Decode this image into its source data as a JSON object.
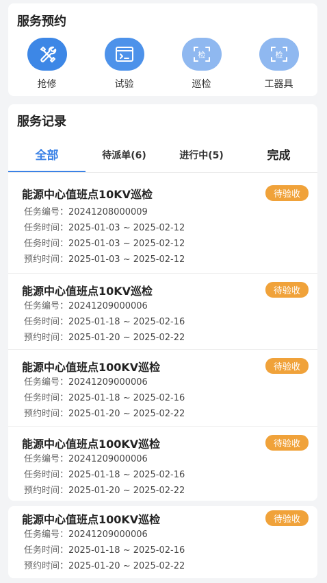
{
  "booking": {
    "title": "服务预约",
    "items": [
      {
        "label": "抢修",
        "icon": "wrench-screwdriver-icon",
        "color": "#3d87e6"
      },
      {
        "label": "试验",
        "icon": "terminal-window-icon",
        "color": "#4d92ea"
      },
      {
        "label": "巡检",
        "icon": "scan-inspect-icon",
        "color": "#8fb8f0"
      },
      {
        "label": "工器具",
        "icon": "scan-inspect-icon",
        "color": "#8fb8f0"
      }
    ]
  },
  "records": {
    "title": "服务记录",
    "tabs": [
      "全部",
      "待派单(6)",
      "进行中(5)",
      "完成"
    ],
    "items": [
      {
        "title": "能源中心值班点10KV巡检",
        "status": "待验收",
        "lines": [
          {
            "label": "任务编号：",
            "value": "20241208000009"
          },
          {
            "label": "任务时间：",
            "value": "2025-01-03 ~ 2025-02-12"
          },
          {
            "label": "任务时间：",
            "value": "2025-01-03 ~ 2025-02-12"
          },
          {
            "label": "预约时间：",
            "value": "2025-01-03 ~ 2025-02-12"
          }
        ]
      },
      {
        "title": "能源中心值班点10KV巡检",
        "status": "待验收",
        "lines": [
          {
            "label": "任务编号：",
            "value": "20241209000006"
          },
          {
            "label": "任务时间：",
            "value": "2025-01-18 ~ 2025-02-16"
          },
          {
            "label": "预约时间：",
            "value": "2025-01-20 ~ 2025-02-22"
          }
        ]
      },
      {
        "title": "能源中心值班点100KV巡检",
        "status": "待验收",
        "lines": [
          {
            "label": "任务编号：",
            "value": "20241209000006"
          },
          {
            "label": "任务时间：",
            "value": "2025-01-18 ~ 2025-02-16"
          },
          {
            "label": "预约时间：",
            "value": "2025-01-20 ~ 2025-02-22"
          }
        ]
      },
      {
        "title": "能源中心值班点100KV巡检",
        "status": "待验收",
        "lines": [
          {
            "label": "任务编号：",
            "value": "20241209000006"
          },
          {
            "label": "任务时间：",
            "value": "2025-01-18 ~ 2025-02-16"
          },
          {
            "label": "预约时间：",
            "value": "2025-01-20 ~ 2025-02-22"
          }
        ]
      },
      {
        "title": "能源中心值班点100KV巡检",
        "status": "待验收",
        "lines": [
          {
            "label": "任务编号：",
            "value": "20241209000006"
          },
          {
            "label": "任务时间：",
            "value": "2025-01-18 ~ 2025-02-16"
          },
          {
            "label": "预约时间：",
            "value": "2025-01-20 ~ 2025-02-22"
          }
        ]
      }
    ]
  }
}
